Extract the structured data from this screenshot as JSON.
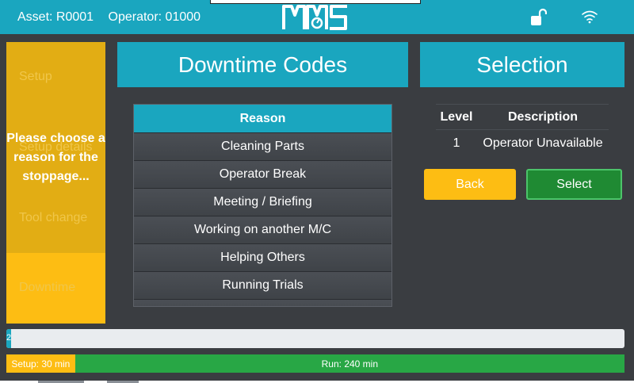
{
  "header": {
    "asset": "Asset: R0001",
    "operator": "Operator: 01000",
    "logo_text": "MMS",
    "icons": [
      "lock-open-icon",
      "wifi-icon"
    ]
  },
  "sidebar": {
    "items": [
      {
        "label": "Setup"
      },
      {
        "label": "Setup details"
      },
      {
        "label": "Tool change"
      },
      {
        "label": "Downtime"
      }
    ],
    "overlay_message": "Please choose a reason for the stoppage..."
  },
  "downtime_codes": {
    "title": "Downtime Codes",
    "column_header": "Reason",
    "rows": [
      "Cleaning Parts",
      "Operator Break",
      "Meeting / Briefing",
      "Working on another M/C",
      "Helping Others",
      "Running Trials"
    ]
  },
  "selection": {
    "title": "Selection",
    "columns": [
      "Level",
      "Description"
    ],
    "rows": [
      {
        "level": "1",
        "description": "Operator Unavailable"
      }
    ],
    "back_label": "Back",
    "select_label": "Select"
  },
  "progress": {
    "label": "2",
    "fraction": 0.008
  },
  "time_bar": {
    "setup_label": "Setup: 30 min",
    "run_label": "Run: 240 min",
    "setup_minutes": 30,
    "run_minutes": 240
  },
  "colors": {
    "accent": "#1aa6bf",
    "background": "#3a3d41",
    "warning": "#fdbd13",
    "success": "#28a745"
  }
}
